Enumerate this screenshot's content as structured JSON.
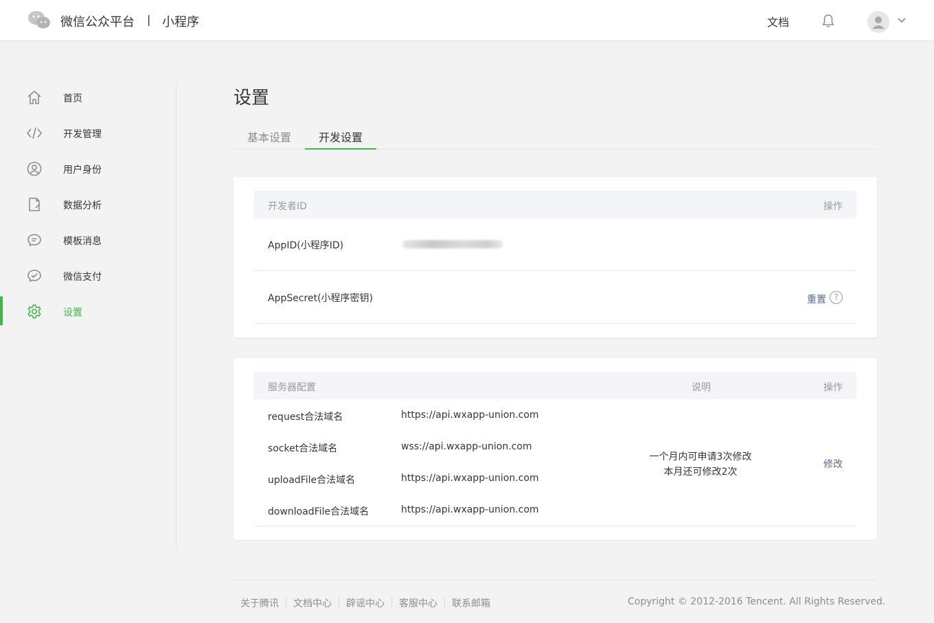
{
  "header": {
    "brand": "微信公众平台",
    "separator": "|",
    "product": "小程序",
    "doc_link": "文档"
  },
  "sidebar": {
    "items": [
      {
        "label": "首页",
        "icon": "home-icon"
      },
      {
        "label": "开发管理",
        "icon": "code-icon"
      },
      {
        "label": "用户身份",
        "icon": "user-circle-icon"
      },
      {
        "label": "数据分析",
        "icon": "document-chart-icon"
      },
      {
        "label": "模板消息",
        "icon": "chat-bubble-icon"
      },
      {
        "label": "微信支付",
        "icon": "pay-icon"
      },
      {
        "label": "设置",
        "icon": "gear-icon",
        "active": true
      }
    ],
    "active_color": "#44b549"
  },
  "main": {
    "title": "设置",
    "tabs": [
      {
        "label": "基本设置",
        "active": false
      },
      {
        "label": "开发设置",
        "active": true
      }
    ],
    "developer": {
      "col_id": "开发者ID",
      "col_action": "操作",
      "appid_label": "AppID(小程序ID)",
      "appsecret_label": "AppSecret(小程序密钥)",
      "reset_label": "重置",
      "help_glyph": "?"
    },
    "server": {
      "col_config": "服务器配置",
      "col_desc": "说明",
      "col_action": "操作",
      "rows": [
        {
          "name": "request合法域名",
          "value": "https://api.wxapp-union.com"
        },
        {
          "name": "socket合法域名",
          "value": "wss://api.wxapp-union.com"
        },
        {
          "name": "uploadFile合法域名",
          "value": "https://api.wxapp-union.com"
        },
        {
          "name": "downloadFile合法域名",
          "value": "https://api.wxapp-union.com"
        }
      ],
      "note_line1": "一个月内可申请3次修改",
      "note_line2": "本月还可修改2次",
      "modify_label": "修改"
    }
  },
  "footer": {
    "links": [
      "关于腾讯",
      "文档中心",
      "辟谣中心",
      "客服中心",
      "联系邮箱"
    ],
    "copyright": "Copyright © 2012-2016 Tencent. All Rights Reserved."
  },
  "colors": {
    "accent": "#44b549",
    "link": "#576b95",
    "background": "#f3f3f4"
  }
}
